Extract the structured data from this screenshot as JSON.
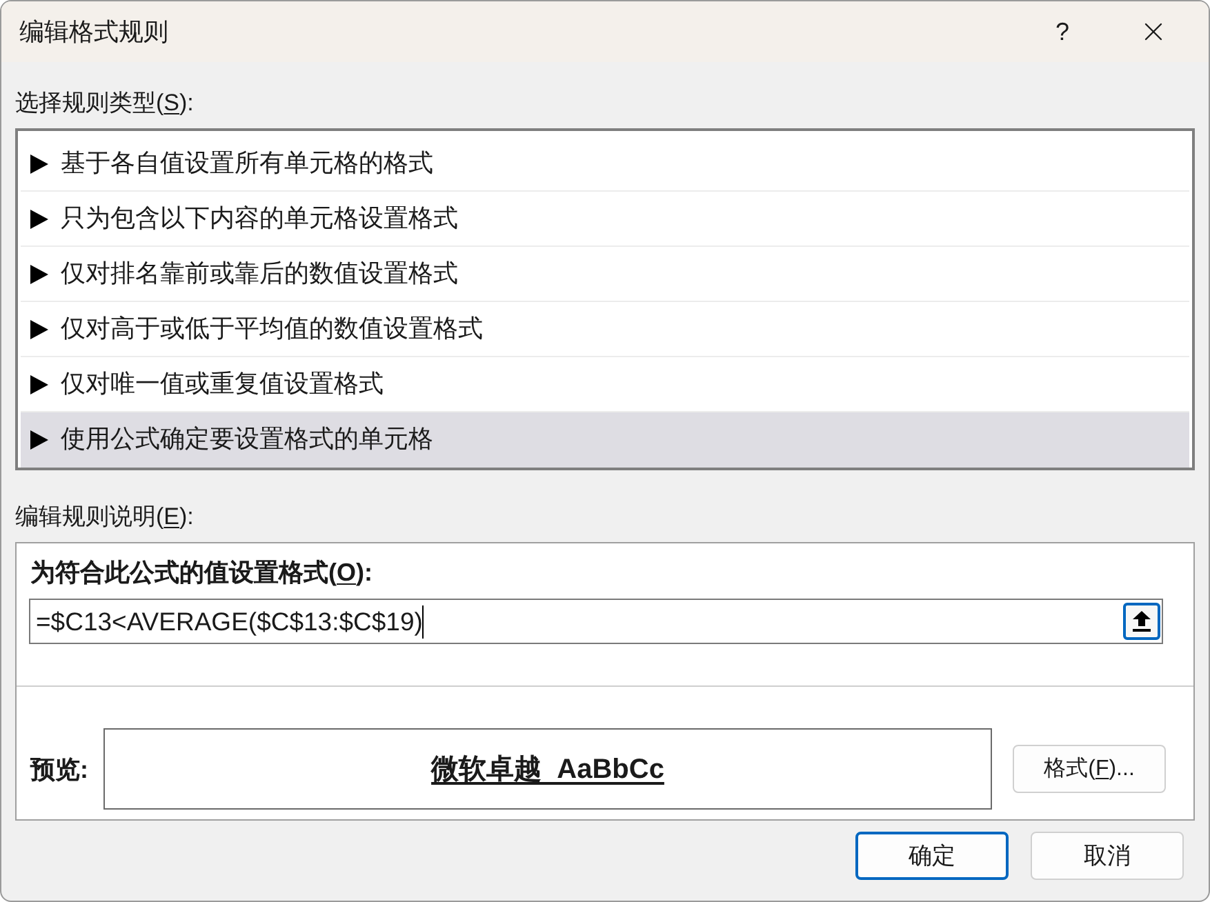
{
  "window": {
    "title": "编辑格式规则",
    "help": "?"
  },
  "rule_type": {
    "label": {
      "before": "选择规则类型(",
      "key": "S",
      "after": "):"
    },
    "items": [
      {
        "text": "基于各自值设置所有单元格的格式",
        "selected": false
      },
      {
        "text": "只为包含以下内容的单元格设置格式",
        "selected": false
      },
      {
        "text": "仅对排名靠前或靠后的数值设置格式",
        "selected": false
      },
      {
        "text": "仅对高于或低于平均值的数值设置格式",
        "selected": false
      },
      {
        "text": "仅对唯一值或重复值设置格式",
        "selected": false
      },
      {
        "text": "使用公式确定要设置格式的单元格",
        "selected": true
      }
    ]
  },
  "rule_description": {
    "label": {
      "before": "编辑规则说明(",
      "key": "E",
      "after": "):"
    },
    "formula_label": {
      "before": "为符合此公式的值设置格式(",
      "key": "O",
      "after": "):"
    },
    "formula": {
      "value": "=$C13<AVERAGE($C$13:$C$19)",
      "focused": true
    },
    "preview": {
      "label": "预览:",
      "text": "微软卓越  AaBbCc",
      "bold": true,
      "underline": true
    },
    "format_button": {
      "before": "格式(",
      "key": "F",
      "after": ")..."
    }
  },
  "buttons": [
    {
      "label": "确定",
      "default": true
    },
    {
      "label": "取消",
      "default": false
    }
  ]
}
